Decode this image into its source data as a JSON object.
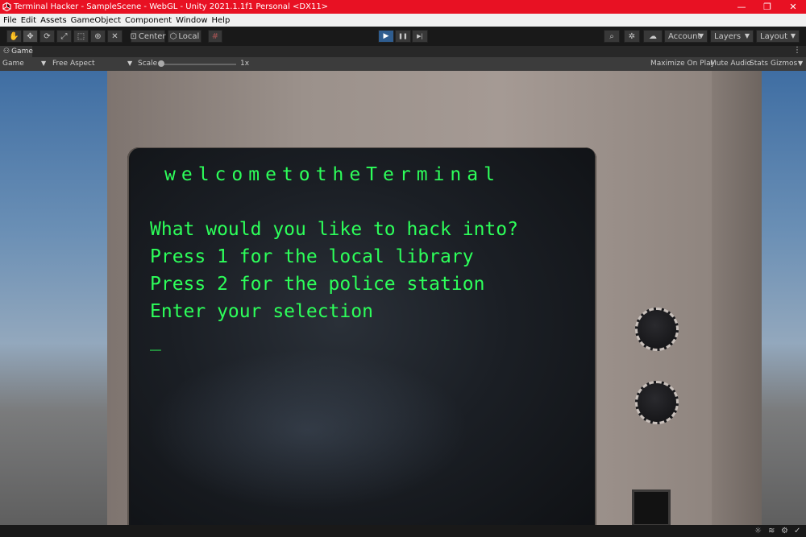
{
  "window": {
    "title": "Terminal Hacker - SampleScene - WebGL - Unity 2021.1.1f1 Personal <DX11>",
    "icon": "unity-logo-icon",
    "controls": {
      "minimize": "—",
      "restore": "❐",
      "close": "✕"
    },
    "accent": "#e81123"
  },
  "menu": [
    "File",
    "Edit",
    "Assets",
    "GameObject",
    "Component",
    "Window",
    "Help"
  ],
  "toolbar": {
    "tools": [
      "hand-icon",
      "move-icon",
      "rotate-icon",
      "scale-icon",
      "rect-icon",
      "transform-icon",
      "custom-tool-icon"
    ],
    "pivot_label": "Center",
    "space_label": "Local",
    "play": "▶",
    "pause": "❚❚",
    "step": "▶|",
    "account_label": "Account",
    "layers_label": "Layers",
    "layout_label": "Layout"
  },
  "tab": {
    "label": "Game"
  },
  "gamebar": {
    "display": "Game",
    "aspect": "Free Aspect",
    "scale_label": "Scale",
    "scale_value": "1x",
    "maximize": "Maximize On Play",
    "mute": "Mute Audio",
    "stats": "Stats",
    "gizmos": "Gizmos"
  },
  "terminal": {
    "heading": "welcometotheTerminal",
    "lines": [
      "What would you like to hack into?",
      "Press 1 for the local library",
      "Press 2 for the police station",
      "Enter your selection"
    ],
    "cursor": "_",
    "text_color": "#2dff5a"
  }
}
